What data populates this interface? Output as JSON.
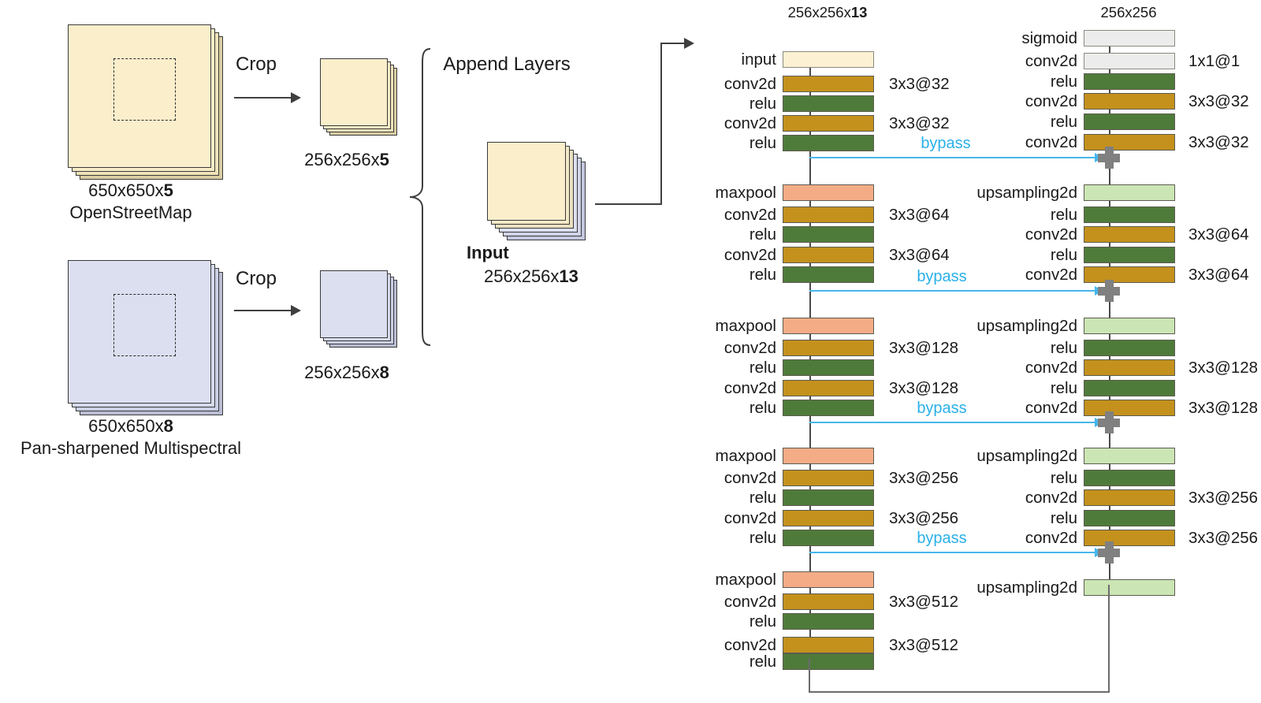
{
  "title": "Dual-source U-Net preprocessing and architecture diagram",
  "sources": [
    {
      "id": "osm",
      "size_label": "650x650x",
      "size_channels": "5",
      "name": "OpenStreetMap",
      "crop_label": "Crop",
      "cropped_label": "256x256x",
      "cropped_channels": "5",
      "color": "#fbeecb"
    },
    {
      "id": "pan-sharpened-multispectral",
      "size_label": "650x650x",
      "size_channels": "8",
      "name": "Pan-sharpened Multispectral",
      "crop_label": "Crop",
      "cropped_label": "256x256x",
      "cropped_channels": "8",
      "color": "#dcdff0"
    }
  ],
  "append": {
    "title": "Append Layers",
    "input_label": "Input",
    "input_size": "256x256x",
    "input_channels": "13"
  },
  "network": {
    "encoder_top_label": "256x256x",
    "encoder_top_channels": "13",
    "decoder_top_label": "256x256",
    "bypass_label": "bypass",
    "encoder": [
      {
        "name": "input",
        "kind": "input",
        "param": ""
      },
      {
        "name": "conv2d",
        "kind": "conv",
        "param": "3x3@32"
      },
      {
        "name": "relu",
        "kind": "relu",
        "param": ""
      },
      {
        "name": "conv2d",
        "kind": "conv",
        "param": "3x3@32"
      },
      {
        "name": "relu",
        "kind": "relu",
        "param": ""
      },
      {
        "name": "maxpool",
        "kind": "pool",
        "param": ""
      },
      {
        "name": "conv2d",
        "kind": "conv",
        "param": "3x3@64"
      },
      {
        "name": "relu",
        "kind": "relu",
        "param": ""
      },
      {
        "name": "conv2d",
        "kind": "conv",
        "param": "3x3@64"
      },
      {
        "name": "relu",
        "kind": "relu",
        "param": ""
      },
      {
        "name": "maxpool",
        "kind": "pool",
        "param": ""
      },
      {
        "name": "conv2d",
        "kind": "conv",
        "param": "3x3@128"
      },
      {
        "name": "relu",
        "kind": "relu",
        "param": ""
      },
      {
        "name": "conv2d",
        "kind": "conv",
        "param": "3x3@128"
      },
      {
        "name": "relu",
        "kind": "relu",
        "param": ""
      },
      {
        "name": "maxpool",
        "kind": "pool",
        "param": ""
      },
      {
        "name": "conv2d",
        "kind": "conv",
        "param": "3x3@256"
      },
      {
        "name": "relu",
        "kind": "relu",
        "param": ""
      },
      {
        "name": "conv2d",
        "kind": "conv",
        "param": "3x3@256"
      },
      {
        "name": "relu",
        "kind": "relu",
        "param": ""
      },
      {
        "name": "maxpool",
        "kind": "pool",
        "param": ""
      },
      {
        "name": "conv2d",
        "kind": "conv",
        "param": "3x3@512"
      },
      {
        "name": "relu",
        "kind": "relu",
        "param": ""
      },
      {
        "name": "conv2d",
        "kind": "conv",
        "param": "3x3@512"
      },
      {
        "name": "relu",
        "kind": "relu",
        "param": ""
      }
    ],
    "decoder": [
      {
        "name": "sigmoid",
        "kind": "sigmoid",
        "param": ""
      },
      {
        "name": "conv2d",
        "kind": "sigmoid",
        "param": "1x1@1"
      },
      {
        "name": "relu",
        "kind": "relu",
        "param": ""
      },
      {
        "name": "conv2d",
        "kind": "conv",
        "param": "3x3@32"
      },
      {
        "name": "relu",
        "kind": "relu",
        "param": ""
      },
      {
        "name": "conv2d",
        "kind": "conv",
        "param": "3x3@32"
      },
      {
        "name": "upsampling2d",
        "kind": "upsample",
        "param": ""
      },
      {
        "name": "relu",
        "kind": "relu",
        "param": ""
      },
      {
        "name": "conv2d",
        "kind": "conv",
        "param": "3x3@64"
      },
      {
        "name": "relu",
        "kind": "relu",
        "param": ""
      },
      {
        "name": "conv2d",
        "kind": "conv",
        "param": "3x3@64"
      },
      {
        "name": "upsampling2d",
        "kind": "upsample",
        "param": ""
      },
      {
        "name": "relu",
        "kind": "relu",
        "param": ""
      },
      {
        "name": "conv2d",
        "kind": "conv",
        "param": "3x3@128"
      },
      {
        "name": "relu",
        "kind": "relu",
        "param": ""
      },
      {
        "name": "conv2d",
        "kind": "conv",
        "param": "3x3@128"
      },
      {
        "name": "upsampling2d",
        "kind": "upsample",
        "param": ""
      },
      {
        "name": "relu",
        "kind": "relu",
        "param": ""
      },
      {
        "name": "conv2d",
        "kind": "conv",
        "param": "3x3@256"
      },
      {
        "name": "relu",
        "kind": "relu",
        "param": ""
      },
      {
        "name": "conv2d",
        "kind": "conv",
        "param": "3x3@256"
      },
      {
        "name": "upsampling2d",
        "kind": "upsample",
        "param": ""
      }
    ],
    "colors": {
      "input": "#fcf1d2",
      "conv": "#c4911d",
      "relu": "#4f7b3a",
      "pool": "#f4ac87",
      "upsample": "#cbe5b4",
      "sigmoid": "#ececec",
      "bypass": "#46b6ec",
      "merge": "#808080"
    }
  }
}
